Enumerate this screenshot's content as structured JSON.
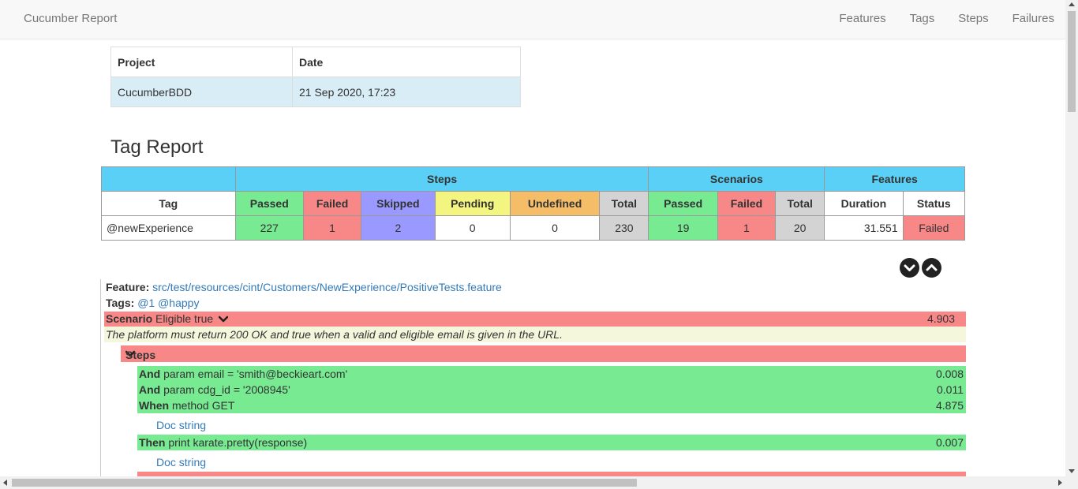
{
  "navbar": {
    "brand": "Cucumber Report",
    "links": [
      "Features",
      "Tags",
      "Steps",
      "Failures"
    ]
  },
  "project_table": {
    "headers": [
      "Project",
      "Date"
    ],
    "row": [
      "CucumberBDD",
      "21 Sep 2020, 17:23"
    ]
  },
  "tag_report": {
    "title": "Tag Report",
    "group_headers": {
      "steps": "Steps",
      "scenarios": "Scenarios",
      "features": "Features"
    },
    "columns": [
      "Tag",
      "Passed",
      "Failed",
      "Skipped",
      "Pending",
      "Undefined",
      "Total",
      "Passed",
      "Failed",
      "Total",
      "Duration",
      "Status"
    ],
    "row": {
      "tag": "@newExperience",
      "steps_passed": "227",
      "steps_failed": "1",
      "steps_skipped": "2",
      "steps_pending": "0",
      "steps_undefined": "0",
      "steps_total": "230",
      "scenarios_passed": "19",
      "scenarios_failed": "1",
      "scenarios_total": "20",
      "duration": "31.551",
      "status": "Failed"
    }
  },
  "feature": {
    "feature_label": "Feature:",
    "feature_path": "src/test/resources/cint/Customers/NewExperience/PositiveTests.feature",
    "tags_label": "Tags:",
    "tags": [
      "@1",
      "@happy"
    ],
    "scenario_keyword": "Scenario",
    "scenario_name": "Eligible true",
    "scenario_duration": "4.903",
    "description": "The platform must return 200 OK and true when a valid and eligible email is given in the URL.",
    "steps_label": "Steps",
    "steps_group1": [
      {
        "keyword": "And",
        "text": "param email = 'smith@beckieart.com'",
        "duration": "0.008"
      },
      {
        "keyword": "And",
        "text": "param cdg_id = '2008945'",
        "duration": "0.011"
      },
      {
        "keyword": "When",
        "text": "method GET",
        "duration": "4.875"
      }
    ],
    "doc_string_1": "Doc string",
    "step_then": {
      "keyword": "Then",
      "text": "print karate.pretty(response)",
      "duration": "0.007"
    },
    "doc_string_2": "Doc string"
  },
  "colors": {
    "passed": "#77ea92",
    "failed": "#f88888",
    "skipped": "#9999ff",
    "pending": "#f4f480",
    "undefined": "#f6bd69",
    "total": "#d3d3d3",
    "header_blue": "#5bd0f6",
    "link": "#337ab7"
  },
  "icons": [
    "chevron-down-circle-icon",
    "chevron-up-circle-icon",
    "chevron-down-icon"
  ]
}
